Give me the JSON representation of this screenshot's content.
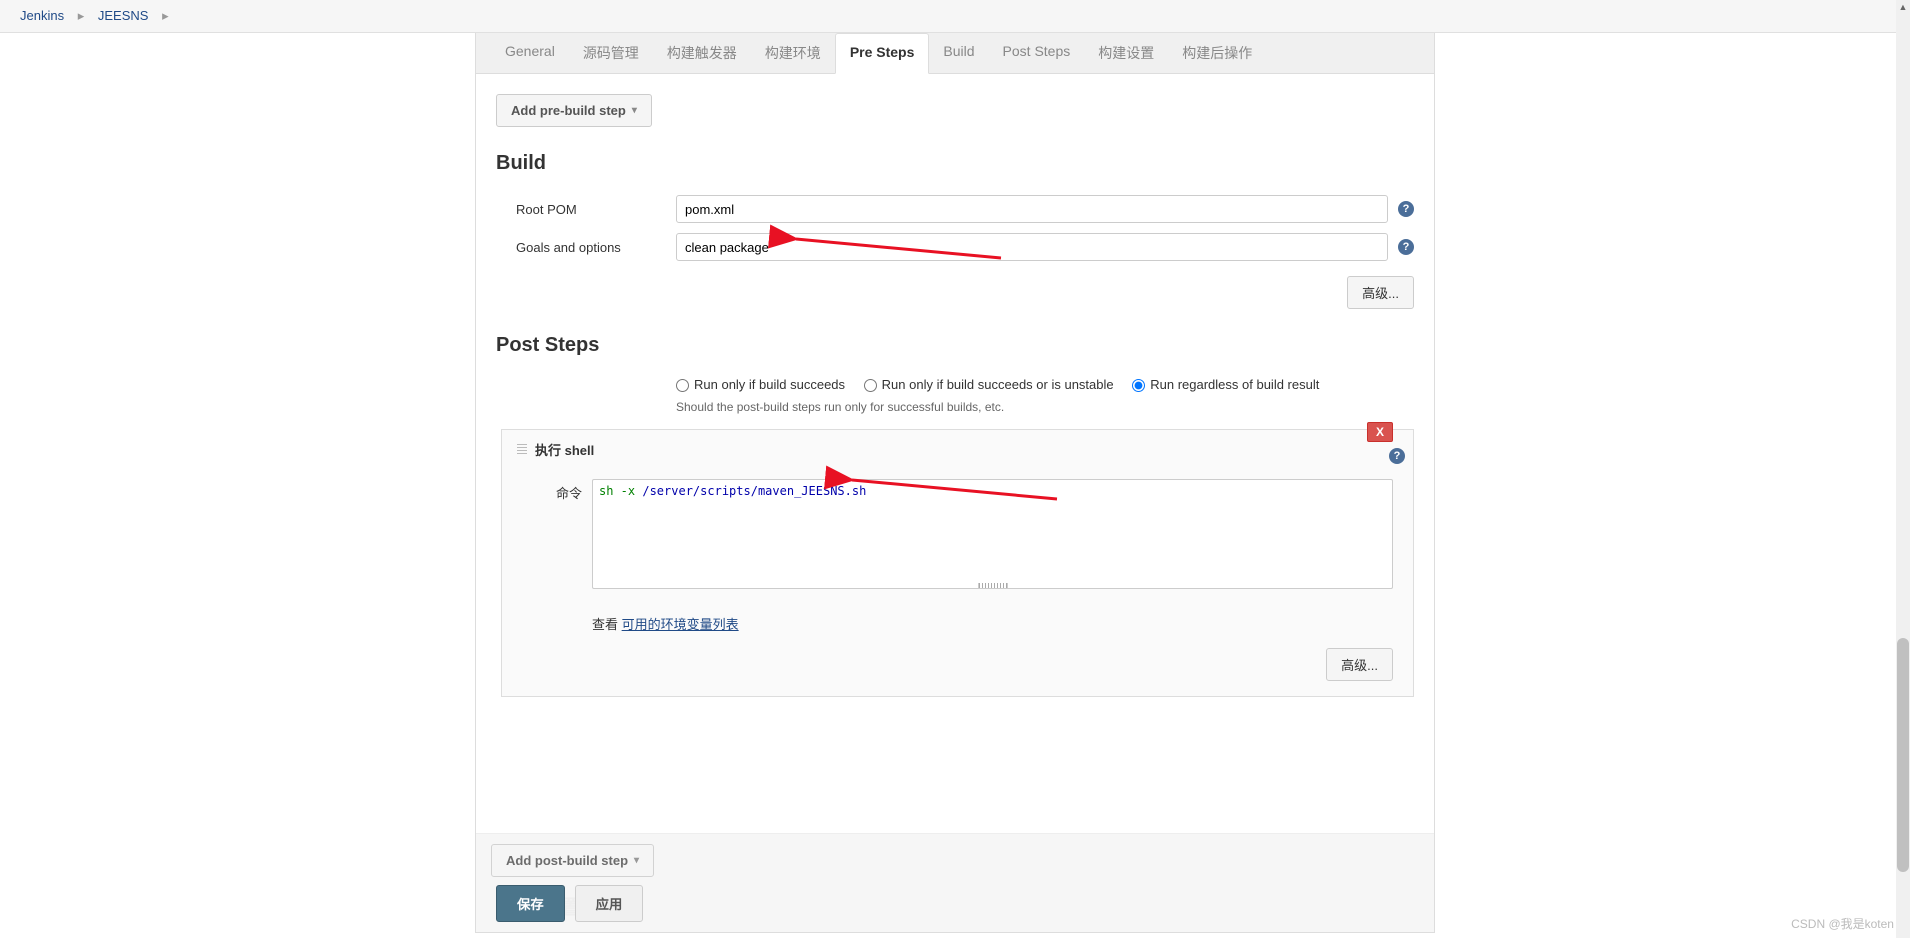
{
  "breadcrumb": {
    "item1": "Jenkins",
    "item2": "JEESNS"
  },
  "tabs": {
    "general": "General",
    "scm": "源码管理",
    "triggers": "构建触发器",
    "env": "构建环境",
    "pre": "Pre Steps",
    "build": "Build",
    "post": "Post Steps",
    "settings": "构建设置",
    "postbuild": "构建后操作"
  },
  "buttons": {
    "add_pre": "Add pre-build step",
    "advanced": "高级...",
    "add_post": "Add post-build step",
    "save": "保存",
    "apply": "应用",
    "close_x": "X"
  },
  "build": {
    "title": "Build",
    "root_pom_label": "Root POM",
    "root_pom_value": "pom.xml",
    "goals_label": "Goals and options",
    "goals_value": "clean package"
  },
  "post_steps": {
    "title": "Post Steps",
    "radio1": "Run only if build succeeds",
    "radio2": "Run only if build succeeds or is unstable",
    "radio3": "Run regardless of build result",
    "hint": "Should the post-build steps run only for successful builds, etc."
  },
  "shell": {
    "header": "执行 shell",
    "cmd_label": "命令",
    "cmd_prefix": "sh -x",
    "cmd_path": "/server/scripts/maven_JEESNS.sh",
    "see_label": "查看 ",
    "link": "可用的环境变量列表"
  },
  "ghost": "构建设置",
  "watermark": "CSDN @我是koten"
}
